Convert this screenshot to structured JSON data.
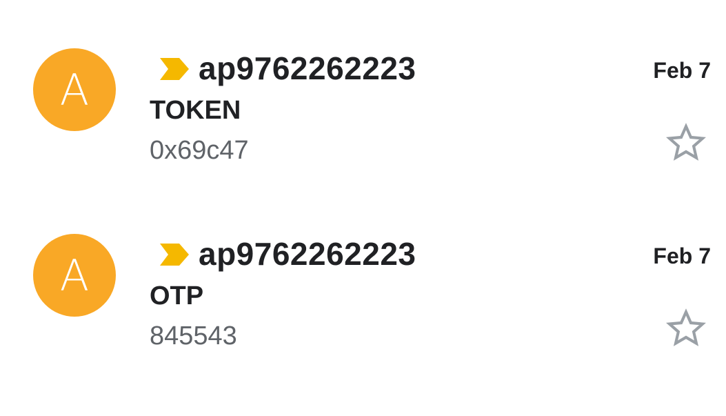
{
  "colors": {
    "avatar": "#F9A826",
    "important_marker": "#F5B800",
    "star_outline": "#9AA0A6"
  },
  "emails": [
    {
      "avatar_letter": "A",
      "sender": "ap9762262223",
      "subject": "TOKEN",
      "snippet": "0x69c47",
      "date": "Feb 7",
      "starred": false,
      "important": true
    },
    {
      "avatar_letter": "A",
      "sender": "ap9762262223",
      "subject": "OTP",
      "snippet": "845543",
      "date": "Feb 7",
      "starred": false,
      "important": true
    }
  ]
}
